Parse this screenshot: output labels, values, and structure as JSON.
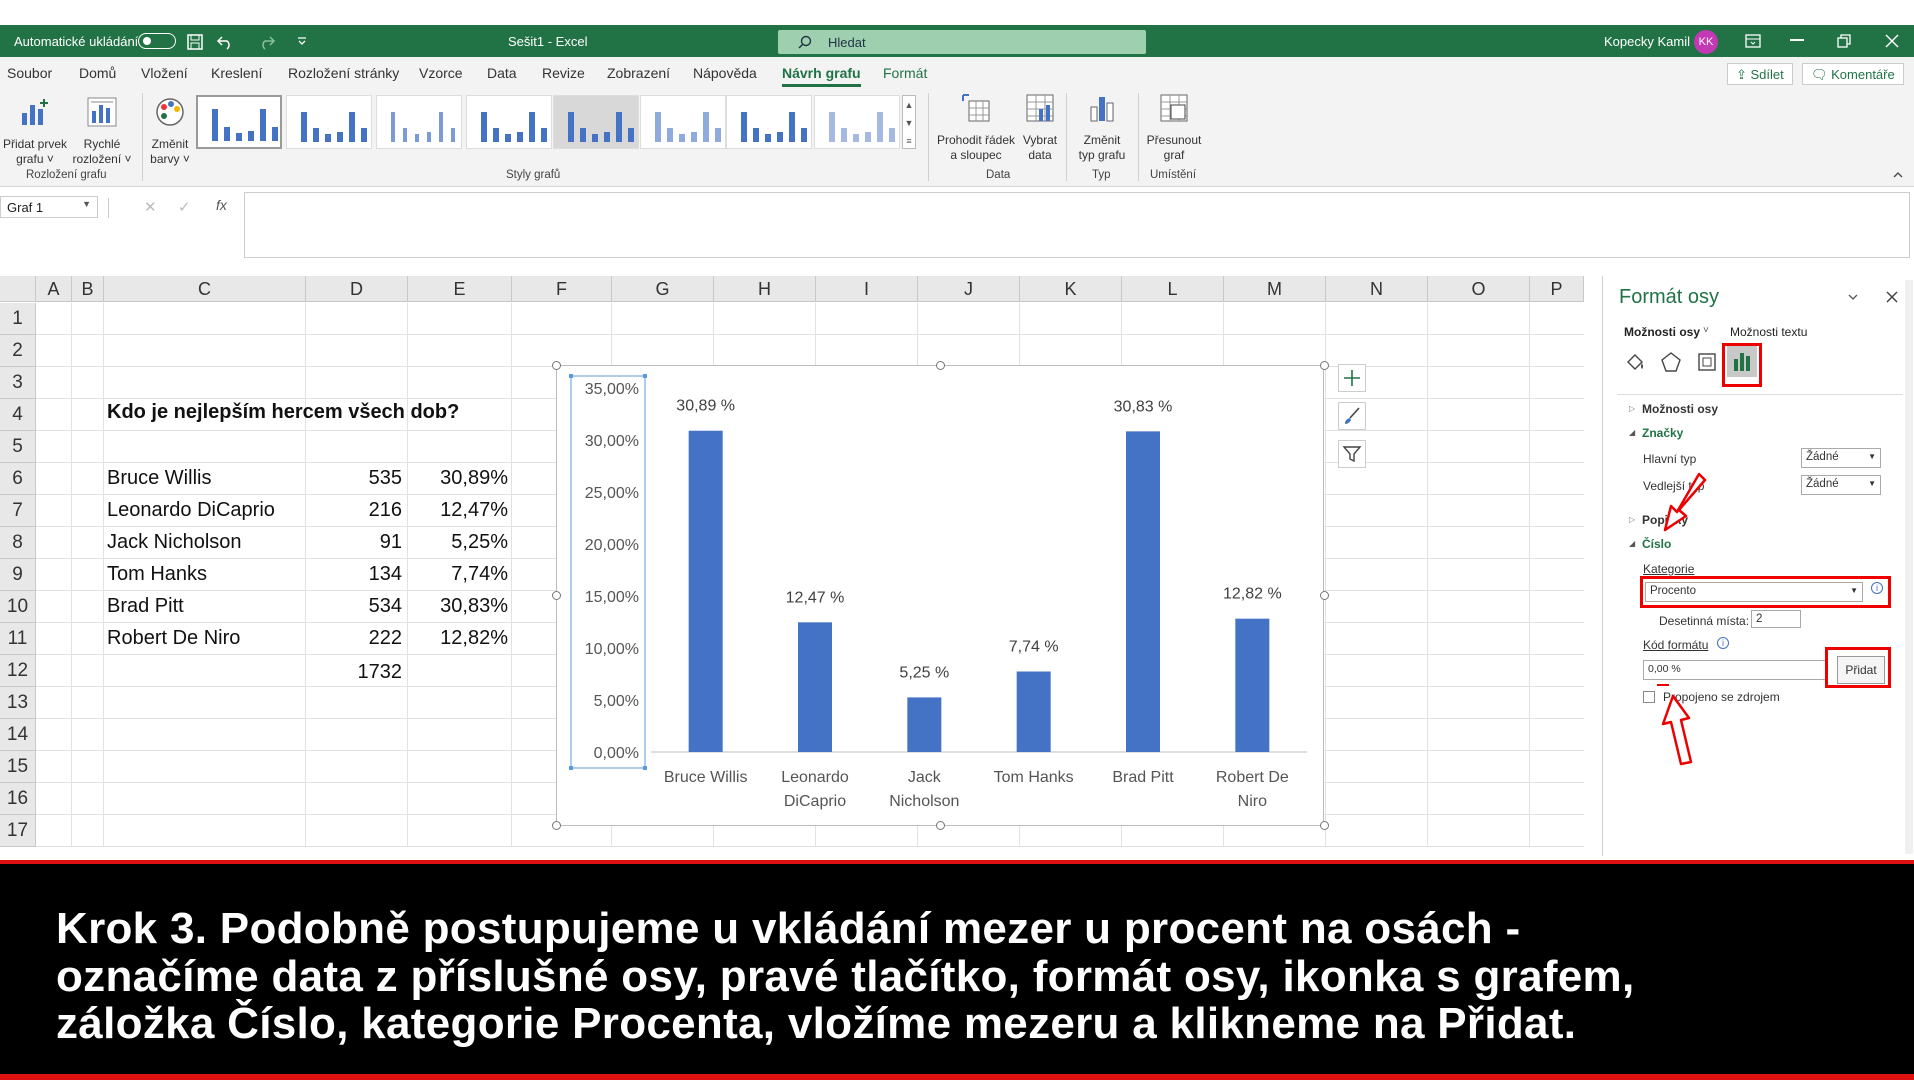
{
  "titlebar": {
    "autosave_label": "Automatické ukládání",
    "file_title": "Sešit1  -  Excel",
    "search_placeholder": "Hledat",
    "user_name": "Kopecky Kamil",
    "user_initials": "KK",
    "accent": "#217346"
  },
  "tabs": [
    "Soubor",
    "Domů",
    "Vložení",
    "Kreslení",
    "Rozložení stránky",
    "Vzorce",
    "Data",
    "Revize",
    "Zobrazení",
    "Nápověda",
    "Návrh grafu",
    "Formát"
  ],
  "active_tab": "Návrh grafu",
  "share_label": "Sdílet",
  "comments_label": "Komentáře",
  "ribbon": {
    "add_element": [
      "Přidat prvek",
      "grafu ˅"
    ],
    "quick_layout": [
      "Rychlé",
      "rozložení ˅"
    ],
    "change_colors": [
      "Změnit",
      "barvy ˅"
    ],
    "switch_row_col": [
      "Prohodit řádek",
      "a sloupec"
    ],
    "select_data": [
      "Vybrat",
      "data"
    ],
    "change_type": [
      "Změnit",
      "typ grafu"
    ],
    "move_chart": [
      "Přesunout",
      "graf"
    ],
    "group_layout": "Rozložení grafu",
    "group_styles": "Styly grafů",
    "group_data": "Data",
    "group_type": "Typ",
    "group_location": "Umístění"
  },
  "formula_bar": {
    "name_box": "Graf 1",
    "fx": "fx"
  },
  "columns": [
    "A",
    "B",
    "C",
    "D",
    "E",
    "F",
    "G",
    "H",
    "I",
    "J",
    "K",
    "L",
    "M",
    "N",
    "O",
    "P"
  ],
  "rows": [
    "1",
    "2",
    "3",
    "4",
    "5",
    "6",
    "7",
    "8",
    "9",
    "10",
    "11",
    "12",
    "13",
    "14",
    "15",
    "16",
    "17"
  ],
  "sheet": {
    "question": "Kdo je nejlepším hercem všech dob?",
    "data": [
      {
        "name": "Bruce Willis",
        "votes": "535",
        "pct": "30,89%"
      },
      {
        "name": "Leonardo DiCaprio",
        "votes": "216",
        "pct": "12,47%"
      },
      {
        "name": "Jack Nicholson",
        "votes": "91",
        "pct": "5,25%"
      },
      {
        "name": "Tom Hanks",
        "votes": "134",
        "pct": "7,74%"
      },
      {
        "name": "Brad Pitt",
        "votes": "534",
        "pct": "30,83%"
      },
      {
        "name": "Robert De Niro",
        "votes": "222",
        "pct": "12,82%"
      }
    ],
    "total": "1732"
  },
  "chart_data": {
    "type": "bar",
    "categories": [
      [
        "Bruce Willis"
      ],
      [
        "Leonardo",
        "DiCaprio"
      ],
      [
        "Jack",
        "Nicholson"
      ],
      [
        "Tom Hanks"
      ],
      [
        "Brad Pitt"
      ],
      [
        "Robert De",
        "Niro"
      ]
    ],
    "values": [
      30.89,
      12.47,
      5.25,
      7.74,
      30.83,
      12.82
    ],
    "data_labels": [
      "30,89 %",
      "12,47 %",
      "5,25 %",
      "7,74 %",
      "30,83 %",
      "12,82 %"
    ],
    "y_ticks": [
      "0,00%",
      "5,00%",
      "10,00%",
      "15,00%",
      "20,00%",
      "25,00%",
      "30,00%",
      "35,00%"
    ],
    "ylim": [
      0,
      35
    ],
    "bar_color": "#4472c4",
    "grid": false
  },
  "pane": {
    "title": "Formát osy",
    "axis_options_tab": "Možnosti osy",
    "text_options_tab": "Možnosti textu",
    "sec_axis_options": "Možnosti osy",
    "sec_marks": "Značky",
    "major_type_label": "Hlavní typ",
    "major_type_value": "Žádné",
    "minor_type_label": "Vedlejší typ",
    "minor_type_value": "Žádné",
    "sec_labels": "Popisky",
    "sec_number": "Číslo",
    "category_label": "Kategorie",
    "category_value": "Procento",
    "decimals_label": "Desetinná místa:",
    "decimals_value": "2",
    "format_code_label": "Kód formátu",
    "format_code_value": "0,00 %",
    "add_button": "Přidat",
    "linked_label": "Propojeno se zdrojem"
  },
  "caption": [
    "Krok 3. Podobně postupujeme u vkládání mezer u procent na osách -",
    "označíme data z příslušné osy, pravé tlačítko, formát osy, ikonka s grafem,",
    "záložka Číslo, kategorie Procenta, vložíme mezeru a klikneme na Přidat."
  ]
}
